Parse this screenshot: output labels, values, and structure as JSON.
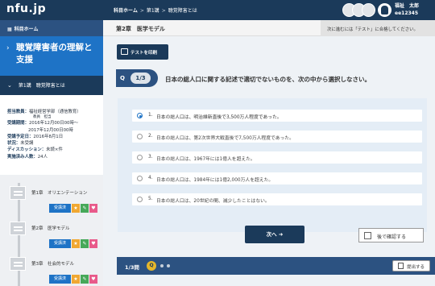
{
  "header": {
    "brand": "nfu.jp",
    "breadcrumb": [
      "科目ホーム",
      "第1講",
      "聴覚障害とは"
    ],
    "user_name": "福祉　太郎",
    "user_id": "ee12345"
  },
  "sidebar": {
    "home": "科目ホーム",
    "course_title": "聴覚障害者の理解と支援",
    "current_lesson": "第1講　聴覚障害とは",
    "meta": {
      "teacher_label": "担当教員：",
      "teacher_value": "福祉経営学部（通信教育）",
      "teacher_sub": "教員　担当",
      "period_label": "受講期間：",
      "period_value": "2016年12月00日00時〜",
      "period_value2": "2017年12月00日00時",
      "schedule_label": "受講予定日：",
      "schedule_value": "2016年8月1日",
      "status_label": "状況：",
      "status_value": "未受講",
      "discussion_label": "ディスカッション：",
      "discussion_value": "未読×件",
      "students_label": "実施済み人数：",
      "students_value": "24人"
    },
    "chapters": [
      {
        "label": "第1章　オリエンテーション",
        "tag": "受講済"
      },
      {
        "label": "第2章　医学モデル",
        "tag": "受講済"
      },
      {
        "label": "第3章　社会的モデル",
        "tag": "受講済"
      }
    ],
    "colors": {
      "star": "#f0a832",
      "edit": "#46a859",
      "heart": "#e85a8a"
    }
  },
  "main": {
    "chapter_title": "第2章　医学モデル",
    "notice": "次に進むには「テスト」に合格してください。",
    "print_button": "テストを印刷",
    "question": {
      "tag": "Q",
      "counter": "1/3",
      "text": "日本の総人口に関する記述で適切でないものを、次の中から選択しなさい。"
    },
    "options": [
      {
        "num": "1.",
        "text": "日本の総人口は、明治維新直後で3,500万人程度であった。",
        "selected": true
      },
      {
        "num": "2.",
        "text": "日本の総人口は、第2次世界大戦直後で7,500万人程度であった。",
        "selected": false
      },
      {
        "num": "3.",
        "text": "日本の総人口は、1967年には1億人を超えた。",
        "selected": false
      },
      {
        "num": "4.",
        "text": "日本の総人口は、1984年には1億2,000万人を超えた。",
        "selected": false
      },
      {
        "num": "5.",
        "text": "日本の総人口は、20世紀の間、減少したことはない。",
        "selected": false
      }
    ],
    "next_button": "次へ ➜",
    "later_label": "後で確認する",
    "footer": {
      "progress": "1/3問",
      "current": "Q",
      "submit_button": "提出する"
    },
    "colors": {
      "primary": "#1b3a5a",
      "accent": "#1e73c6",
      "current_dot": "#e5b72b"
    }
  }
}
